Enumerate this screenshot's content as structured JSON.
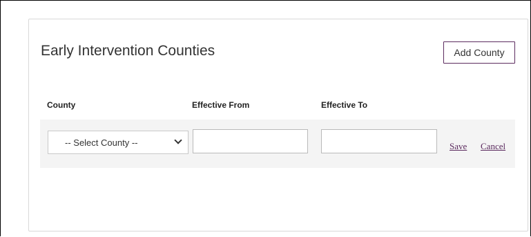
{
  "card": {
    "title": "Early Intervention Counties",
    "add_button_label": "Add County"
  },
  "table": {
    "columns": [
      "County",
      "Effective From",
      "Effective To"
    ],
    "edit_row": {
      "county_select_value": "-- Select County --",
      "effective_from_value": "",
      "effective_to_value": "",
      "save_label": "Save",
      "cancel_label": "Cancel"
    }
  },
  "colors": {
    "accent": "#5b2a5e",
    "row_background": "#f4f4f4",
    "card_border": "#d8d8d8"
  }
}
